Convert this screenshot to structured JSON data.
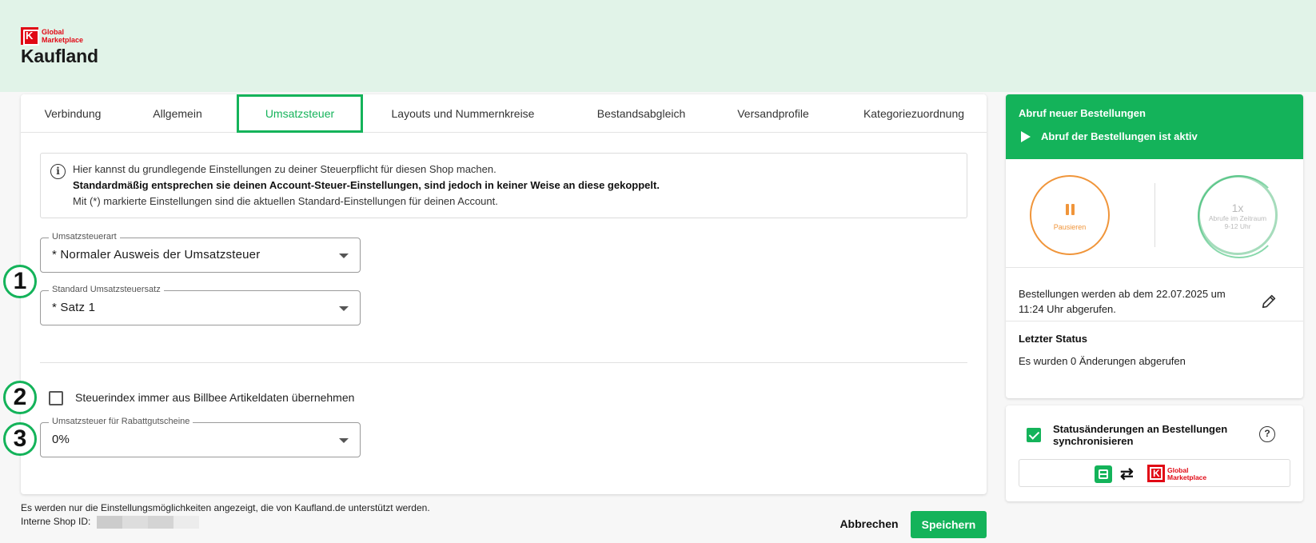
{
  "brand": {
    "logo_line1": "Global",
    "logo_line2": "Marketplace",
    "shop_name": "Kaufland"
  },
  "tabs": [
    {
      "label": "Verbindung"
    },
    {
      "label": "Allgemein"
    },
    {
      "label": "Umsatzsteuer"
    },
    {
      "label": "Layouts und Nummernkreise"
    },
    {
      "label": "Bestandsabgleich"
    },
    {
      "label": "Versandprofile"
    },
    {
      "label": "Kategoriezuordnung"
    }
  ],
  "active_tab": "Umsatzsteuer",
  "info": {
    "line1": "Hier kannst du grundlegende Einstellungen zu deiner Steuerpflicht für diesen Shop machen.",
    "line2": "Standardmäßig entsprechen sie deinen Account-Steuer-Einstellungen, sind jedoch in keiner Weise an diese gekoppelt.",
    "line3": "Mit (*) markierte Einstellungen sind die aktuellen Standard-Einstellungen für deinen Account."
  },
  "fields": {
    "tax_type": {
      "label": "Umsatzsteuerart",
      "value": "* Normaler Ausweis der Umsatzsteuer"
    },
    "tax_rate": {
      "label": "Standard Umsatzsteuersatz",
      "value": "* Satz 1"
    },
    "tax_index_checkbox": {
      "label": "Steuerindex immer aus Billbee Artikeldaten übernehmen",
      "checked": false
    },
    "voucher_tax": {
      "label": "Umsatzsteuer für Rabattgutscheine",
      "value": "0%"
    }
  },
  "markers": [
    "1",
    "2",
    "3"
  ],
  "footer": {
    "note": "Es werden nur die Einstellungsmöglichkeiten angezeigt, die von Kaufland.de unterstützt werden.",
    "shop_id_label": "Interne Shop ID:",
    "cancel": "Abbrechen",
    "save": "Speichern"
  },
  "orders_panel": {
    "title": "Abruf neuer Bestellungen",
    "status": "Abruf der Bestellungen ist aktiv",
    "pause_label": "Pausieren",
    "count": "1x",
    "count_label_1": "Abrufe im Zeitraum",
    "count_label_2": "9-12 Uhr",
    "fetch_text_1": "Bestellungen werden ab dem 22.07.2025 um",
    "fetch_text_2": "11:24 Uhr abgerufen.",
    "last_status_title": "Letzter Status",
    "last_status_text": "Es wurden 0 Änderungen abgerufen"
  },
  "sync_panel": {
    "label_line1": "Statusänderungen an Bestellungen",
    "label_line2": "synchronisieren",
    "checked": true,
    "help": "?",
    "logo_line1": "Global",
    "logo_line2": "Marketplace",
    "swap": "⇄"
  },
  "colors": {
    "accent": "#14b35a",
    "brand_red": "#e10915",
    "pause_orange": "#f0953a",
    "header_band": "#e1f3e8"
  }
}
